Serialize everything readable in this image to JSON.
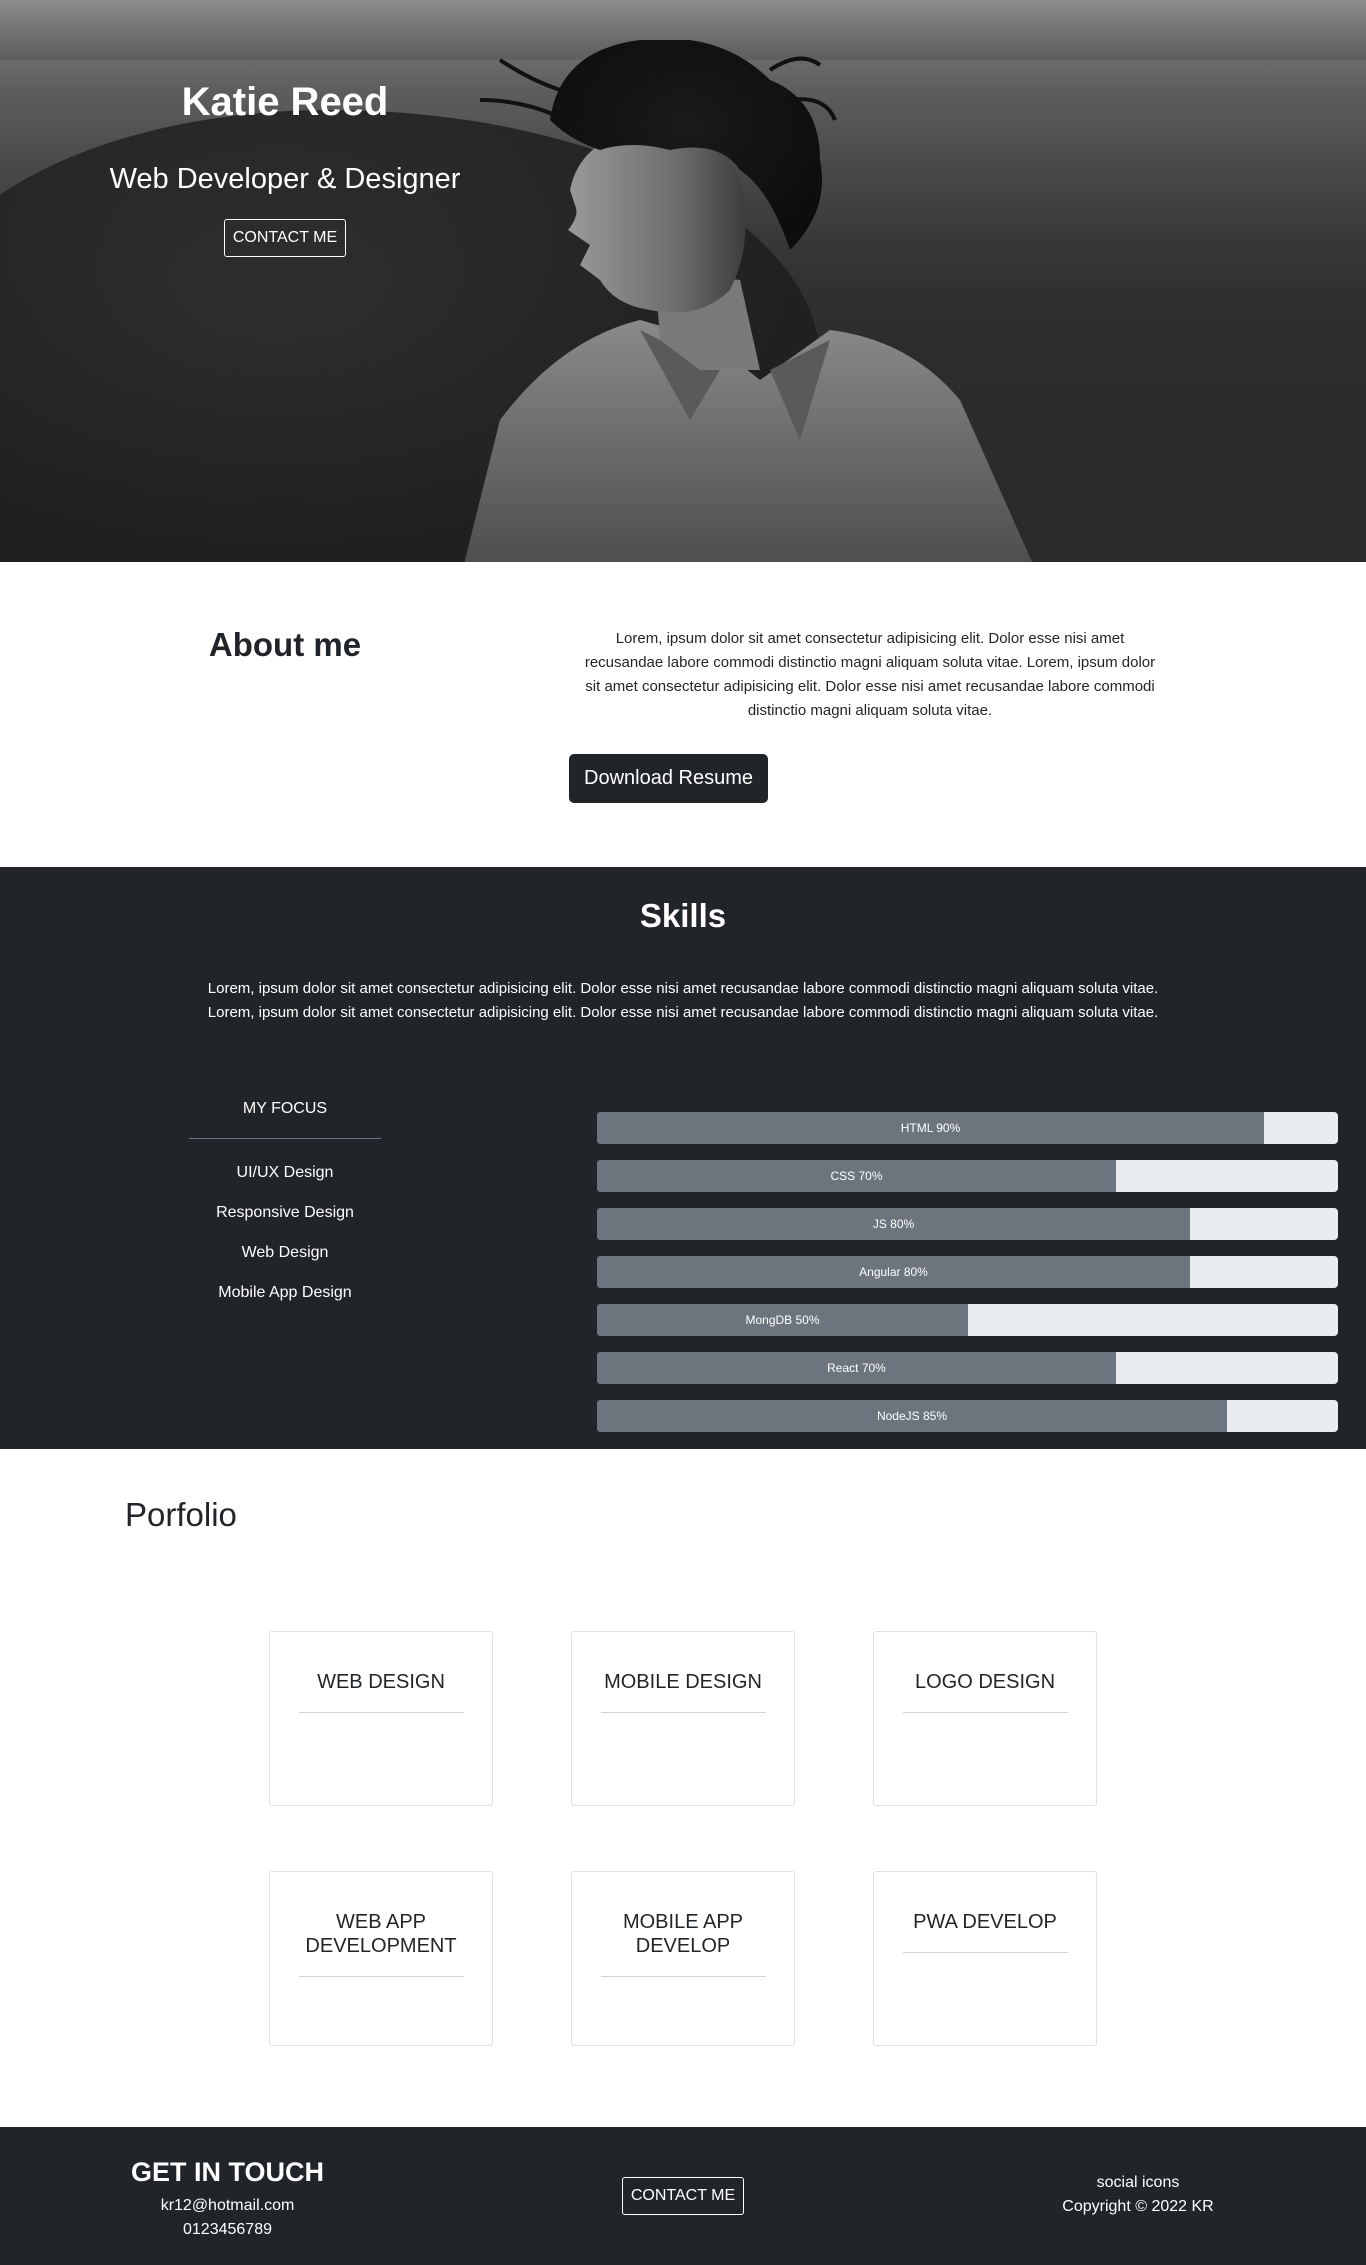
{
  "hero": {
    "name": "Katie Reed",
    "role": "Web Developer & Designer",
    "contact_label": "CONTACT ME"
  },
  "about": {
    "title": "About me",
    "text": "Lorem, ipsum dolor sit amet consectetur adipisicing elit. Dolor esse nisi amet recusandae labore commodi distinctio magni aliquam soluta vitae. Lorem, ipsum dolor sit amet consectetur adipisicing elit. Dolor esse nisi amet recusandae labore commodi distinctio magni aliquam soluta vitae.",
    "download_label": "Download Resume"
  },
  "skills": {
    "title": "Skills",
    "description": "Lorem, ipsum dolor sit amet consectetur adipisicing elit. Dolor esse nisi amet recusandae labore commodi distinctio magni aliquam soluta vitae. Lorem, ipsum dolor sit amet consectetur adipisicing elit. Dolor esse nisi amet recusandae labore commodi distinctio magni aliquam soluta vitae.",
    "focus_title": "MY FOCUS",
    "focus_items": [
      "UI/UX Design",
      "Responsive Design",
      "Web Design",
      "Mobile App Design"
    ],
    "bars": [
      {
        "label": "HTML 90%",
        "percent": 90
      },
      {
        "label": "CSS 70%",
        "percent": 70
      },
      {
        "label": "JS 80%",
        "percent": 80
      },
      {
        "label": "Angular 80%",
        "percent": 80
      },
      {
        "label": "MongDB 50%",
        "percent": 50
      },
      {
        "label": "React 70%",
        "percent": 70
      },
      {
        "label": "NodeJS 85%",
        "percent": 85
      }
    ],
    "colors": {
      "bar_fill": "#6c757d",
      "bar_track": "#e9ecef"
    }
  },
  "portfolio": {
    "title": "Porfolio",
    "cards": [
      {
        "label": "WEB DESIGN"
      },
      {
        "label": "MOBILE DESIGN"
      },
      {
        "label": "LOGO DESIGN"
      },
      {
        "label": "WEB APP DEVELOPMENT"
      },
      {
        "label": "MOBILE APP DEVELOP"
      },
      {
        "label": "PWA DEVELOP"
      }
    ]
  },
  "footer": {
    "title": "GET IN TOUCH",
    "email": "kr12@hotmail.com",
    "phone": "0123456789",
    "contact_label": "CONTACT ME",
    "social": "social icons",
    "copyright": "Copyright © 2022 KR"
  },
  "theme": {
    "dark": "#212529"
  }
}
